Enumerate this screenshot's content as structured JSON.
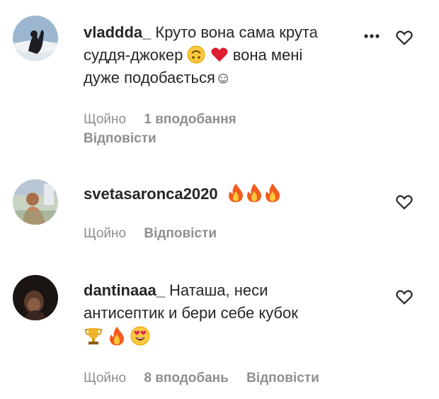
{
  "comments": [
    {
      "username": "vladdda_",
      "text_line1": "Круто вона сама крута",
      "text_line2_a": "суддя-джокер",
      "text_line2_b": "вона мені",
      "text_line3": "дуже подобається☺",
      "time": "Щойно",
      "likes": "1 вподобання",
      "reply": "Відповісти"
    },
    {
      "username": "svetasaronca2020",
      "text": "",
      "time": "Щойно",
      "reply": "Відповісти"
    },
    {
      "username": "dantinaaa_",
      "text_line1": "Наташа, неси",
      "text_line2": "антисептик и бери себе кубок",
      "time": "Щойно",
      "likes": "8 вподобань",
      "reply": "Відповісти"
    }
  ],
  "icons": {
    "heart": "heart-outline-icon",
    "more": "more-dots-icon",
    "emoji_upside_down": "upside-down-face-emoji",
    "emoji_heart": "red-heart-emoji",
    "emoji_fire": "fire-emoji",
    "emoji_trophy": "trophy-emoji",
    "emoji_heart_eyes": "heart-eyes-emoji"
  },
  "colors": {
    "text": "#262626",
    "muted": "#8e8e8e",
    "heart_red": "#e0245e"
  }
}
